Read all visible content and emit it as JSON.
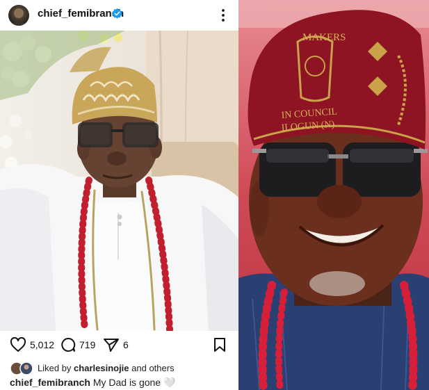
{
  "post": {
    "username": "chief_femibranch",
    "verified": true,
    "likes_count": "5,012",
    "comments_count": "719",
    "shares_count": "6",
    "liked_by_prefix": "Liked by ",
    "liked_by_user": "charlesinojie",
    "liked_by_suffix": " and others",
    "caption_user": "chief_femibranch",
    "caption_text": " My Dad is gone ",
    "caption_emoji": "🤍"
  },
  "hat_text": {
    "line1": "MAKERS",
    "line2": "IN COUNCIL",
    "line3": "ILOGUN (N)"
  },
  "colors": {
    "verified_blue": "#1d9bf0",
    "icon_dark": "#111111",
    "hat_red": "#8e1424"
  }
}
